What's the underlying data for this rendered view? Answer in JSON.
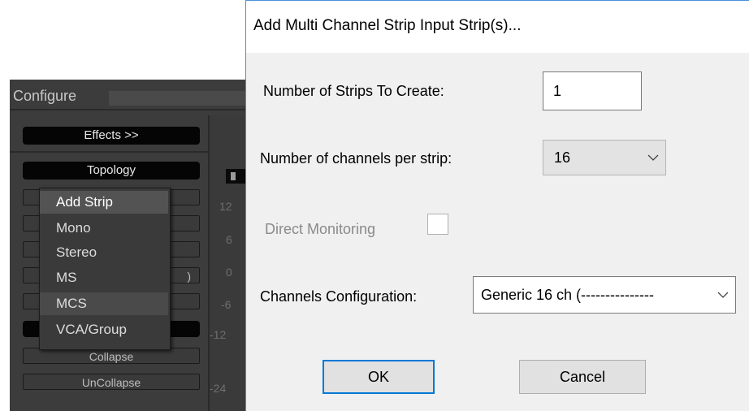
{
  "background_app": {
    "configure_label": "Configure",
    "effects_button": "Effects  >>",
    "topology_button": "Topology",
    "collapse_button": "Collapse",
    "uncollapse_button": "UnCollapse",
    "slot_partial_text": ")",
    "scale_labels": [
      "12",
      "6",
      "0",
      "-6",
      "-12",
      "-24"
    ],
    "popup_menu": {
      "items": [
        "Add Strip",
        "Mono",
        "Stereo",
        "MS",
        "MCS",
        "VCA/Group"
      ],
      "highlighted": "Add Strip"
    }
  },
  "dialog": {
    "title": "Add Multi Channel Strip Input Strip(s)...",
    "strips_label": "Number of Strips To Create:",
    "strips_value": "1",
    "channels_label": "Number of channels per strip:",
    "channels_value": "16",
    "direct_monitoring_label": "Direct Monitoring",
    "direct_monitoring_checked": false,
    "config_label": "Channels Configuration:",
    "config_value": "Generic 16 ch (---------------",
    "ok_label": "OK",
    "cancel_label": "Cancel"
  },
  "colors": {
    "dialog_bg": "#f0f0f0",
    "app_bg": "#3c3c3c",
    "accent": "#0078d7"
  }
}
